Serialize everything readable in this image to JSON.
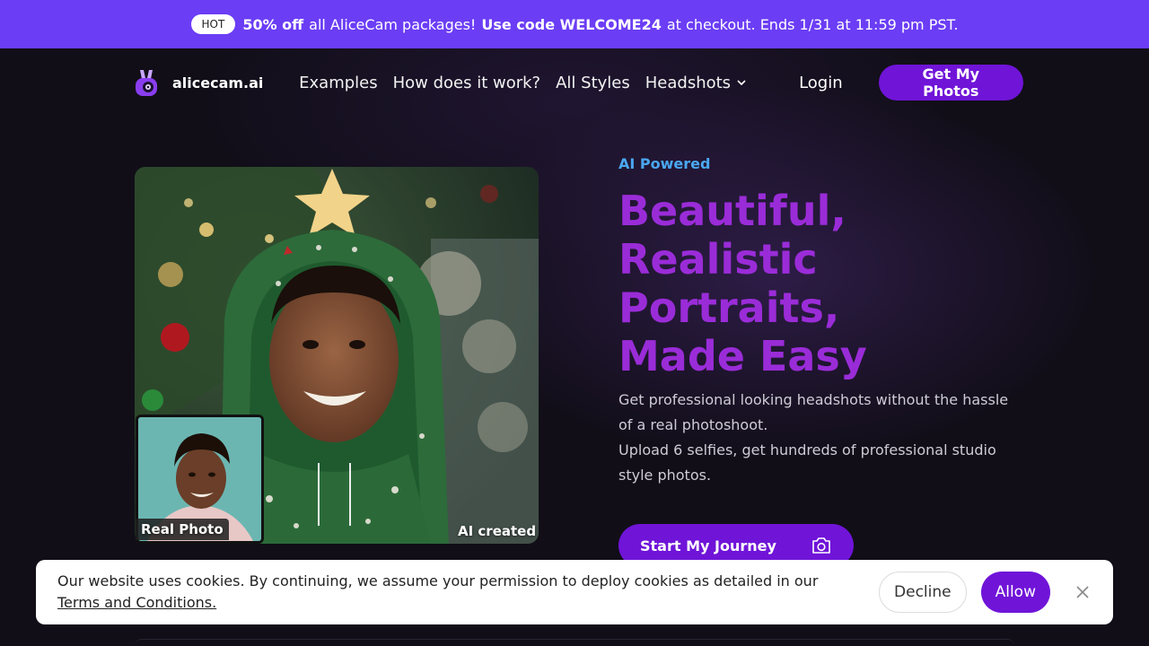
{
  "promo": {
    "badge": "HOT",
    "highlight": "50% off",
    "text1": "all AliceCam packages!",
    "code_label": "Use code WELCOME24",
    "text2": "at checkout. Ends 1/31 at 11:59 pm PST."
  },
  "header": {
    "logo_text": "alicecam.ai",
    "nav": [
      {
        "label": "Examples"
      },
      {
        "label": "How does it work?"
      },
      {
        "label": "All Styles"
      },
      {
        "label": "Headshots",
        "icon": "chevron-down-icon"
      }
    ],
    "login": "Login",
    "cta": "Get My Photos"
  },
  "hero": {
    "eyebrow": "AI Powered",
    "headline": [
      "Beautiful,",
      "Realistic",
      "Portraits,",
      "Made Easy"
    ],
    "subtext1": "Get professional looking headshots without the hassle of a real photoshoot.",
    "subtext2": "Upload 6 selfies, get hundreds of professional studio style photos.",
    "cta": "Start My Journey",
    "cta_icon": "camera-icon",
    "real_caption": "Real Photo",
    "ai_caption": "AI created"
  },
  "cookie": {
    "text": "Our website uses cookies. By continuing, we assume your permission to deploy cookies as detailed in our",
    "link": "Terms and Conditions.",
    "decline": "Decline",
    "allow": "Allow",
    "close_icon": "close-icon"
  },
  "colors": {
    "promo_bg": "#6b3df5",
    "accent": "#7014d8",
    "headline": "#9a2cd8",
    "eyebrow": "#4aa7f0"
  }
}
